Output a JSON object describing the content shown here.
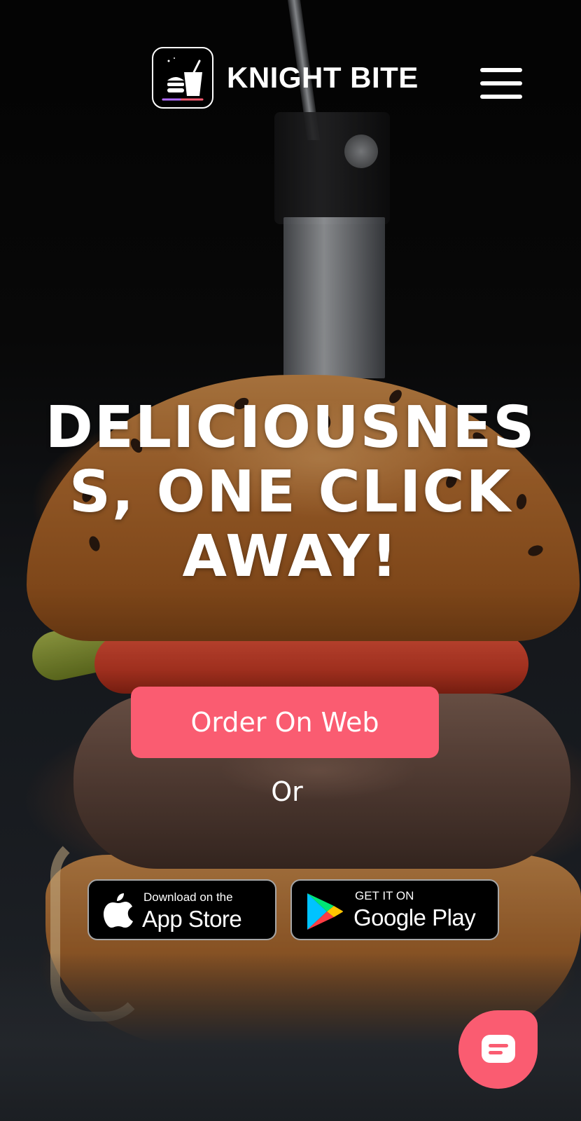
{
  "header": {
    "brand_name": "KNIGHT BITE",
    "logo_icon": "fast-food-cup-burger-logo",
    "menu_icon": "hamburger-menu-icon"
  },
  "hero": {
    "headline": "DELICIOUSNESS, ONE CLICK AWAY!",
    "order_button_label": "Order On Web",
    "separator_text": "Or"
  },
  "stores": {
    "app_store": {
      "small_text": "Download on the",
      "big_text": "App Store",
      "icon": "apple-icon"
    },
    "google_play": {
      "small_text": "GET IT ON",
      "big_text": "Google Play",
      "icon": "google-play-icon"
    }
  },
  "chat": {
    "icon": "chat-bubble-icon"
  },
  "colors": {
    "accent": "#fa5c71",
    "text": "#ffffff",
    "store_badge_bg": "#000000"
  }
}
